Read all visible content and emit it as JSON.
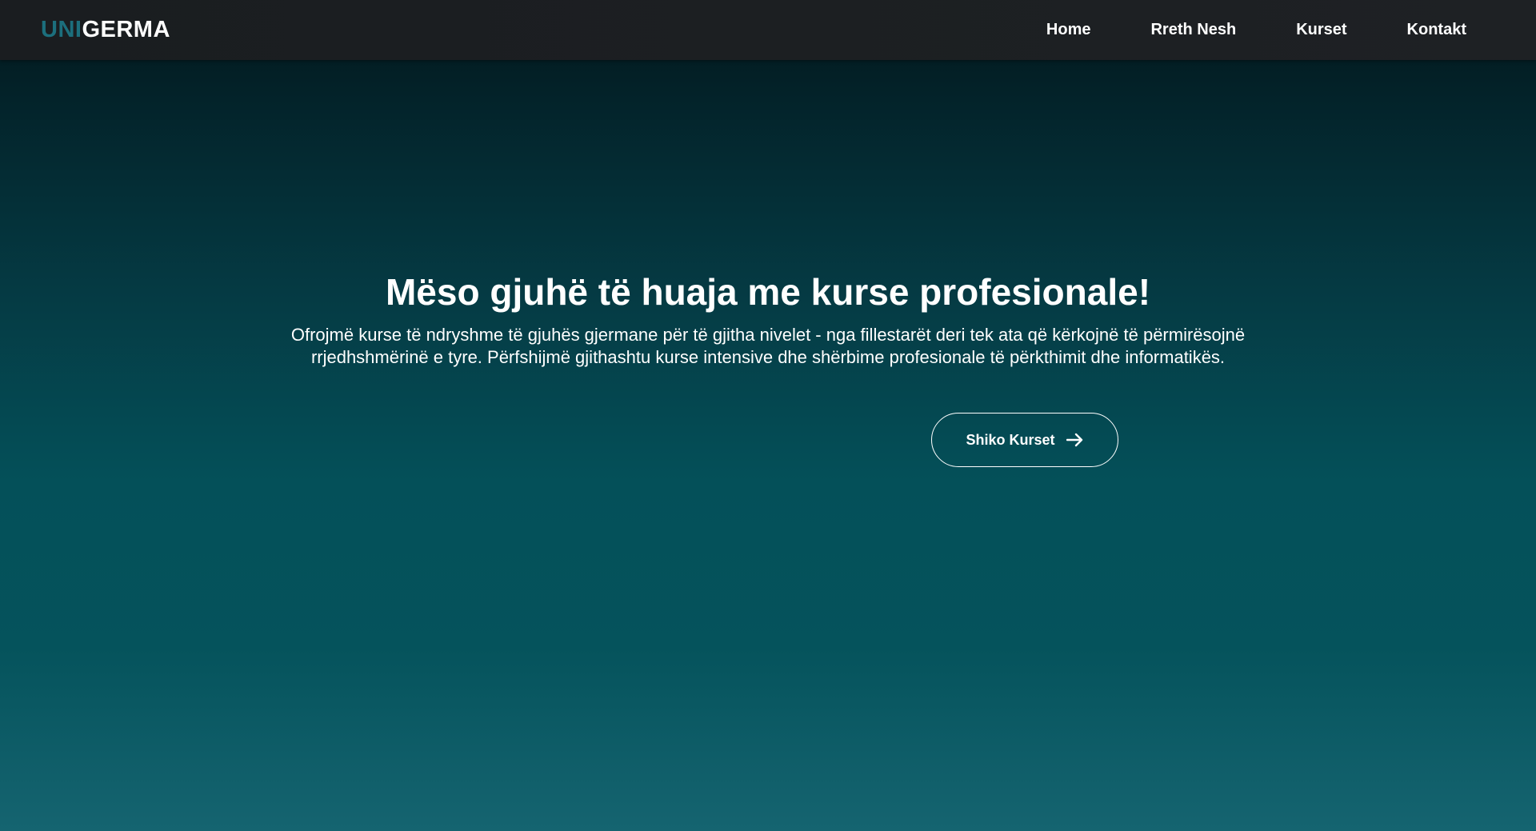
{
  "header": {
    "logo": {
      "accent_text": "UNI",
      "main_text": "GERMA"
    },
    "nav": [
      {
        "label": "Home"
      },
      {
        "label": "Rreth Nesh"
      },
      {
        "label": "Kurset"
      },
      {
        "label": "Kontakt"
      }
    ]
  },
  "hero": {
    "title": "Mëso gjuhë të huaja me kurse profesionale!",
    "description": "Ofrojmë kurse të ndryshme të gjuhës gjermane për të gjitha nivelet - nga fillestarët deri tek ata që kërkojnë të përmirësojnë rrjedhshmërinë e tyre. Përfshijmë gjithashtu kurse intensive dhe shërbime profesionale të përkthimit dhe informatikës.",
    "cta": {
      "label": "Shiko Kurset",
      "icon": "arrow-right-icon"
    }
  },
  "colors": {
    "logo_accent": "#1c6f7d",
    "navbar_bg": "#1e2124",
    "hero_gradient_top": "#02161a",
    "hero_gradient_bottom": "#156470",
    "text": "#ffffff"
  }
}
